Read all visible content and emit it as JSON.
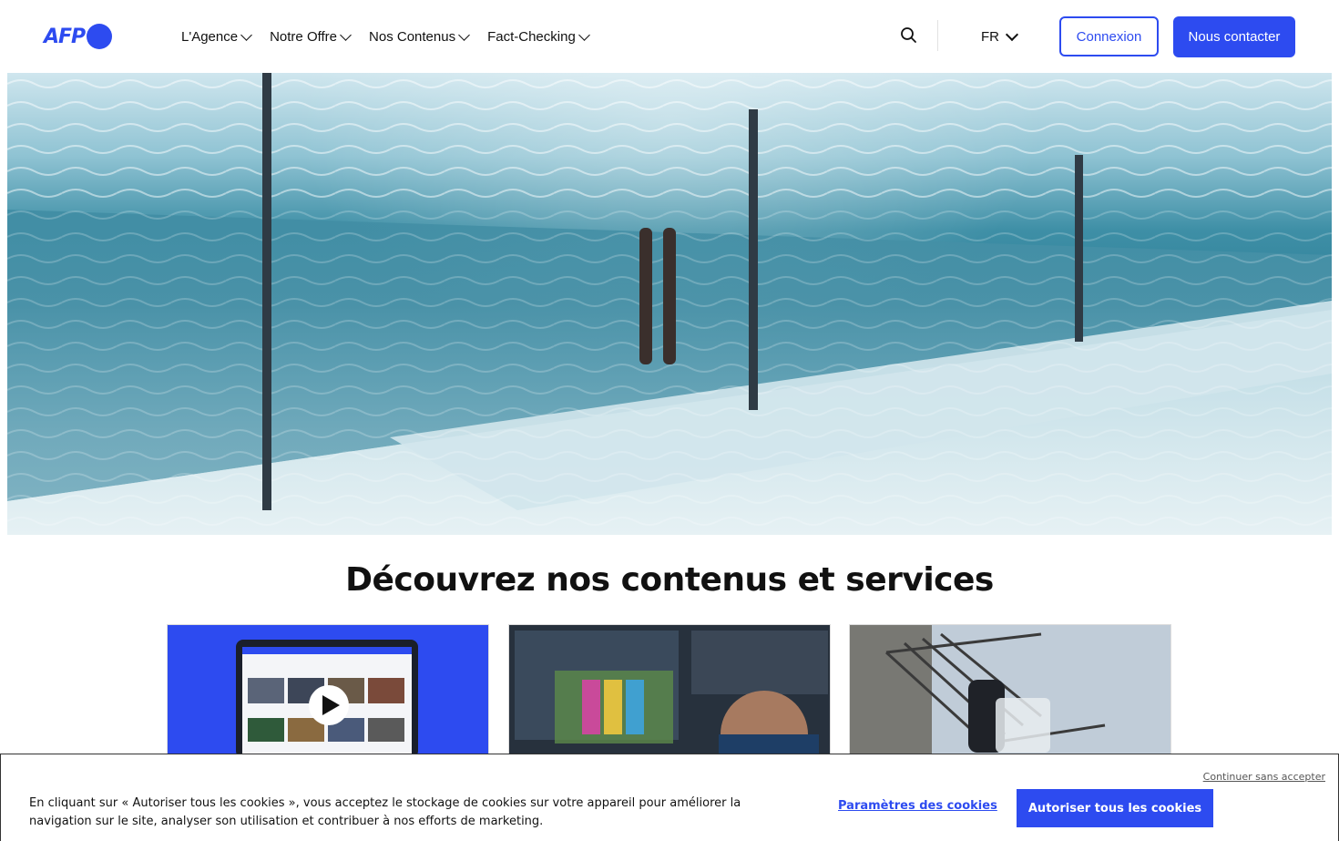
{
  "header": {
    "logo_text": "AFP",
    "nav": [
      {
        "label": "L'Agence"
      },
      {
        "label": "Notre Offre"
      },
      {
        "label": "Nos Contenus"
      },
      {
        "label": "Fact-Checking"
      }
    ],
    "search_icon": "search-icon",
    "language": "FR",
    "login_label": "Connexion",
    "contact_label": "Nous contacter"
  },
  "hero": {
    "image": "underwater-swimming-pool-photo"
  },
  "main": {
    "section_title": "Découvrez nos contenus et services",
    "cards": [
      {
        "image": "laptop-video-platform"
      },
      {
        "image": "tv-control-room"
      },
      {
        "image": "riot-police-barrier"
      }
    ]
  },
  "cookie_banner": {
    "skip_label": "Continuer sans accepter",
    "text": "En cliquant sur « Autoriser tous les cookies », vous acceptez le stockage de cookies sur votre appareil pour améliorer la navigation sur le site, analyser son utilisation et contribuer à nos efforts de marketing.",
    "settings_label": "Paramètres des cookies",
    "accept_label": "Autoriser tous les cookies"
  },
  "colors": {
    "brand": "#2d4bf0",
    "text": "#111111"
  }
}
